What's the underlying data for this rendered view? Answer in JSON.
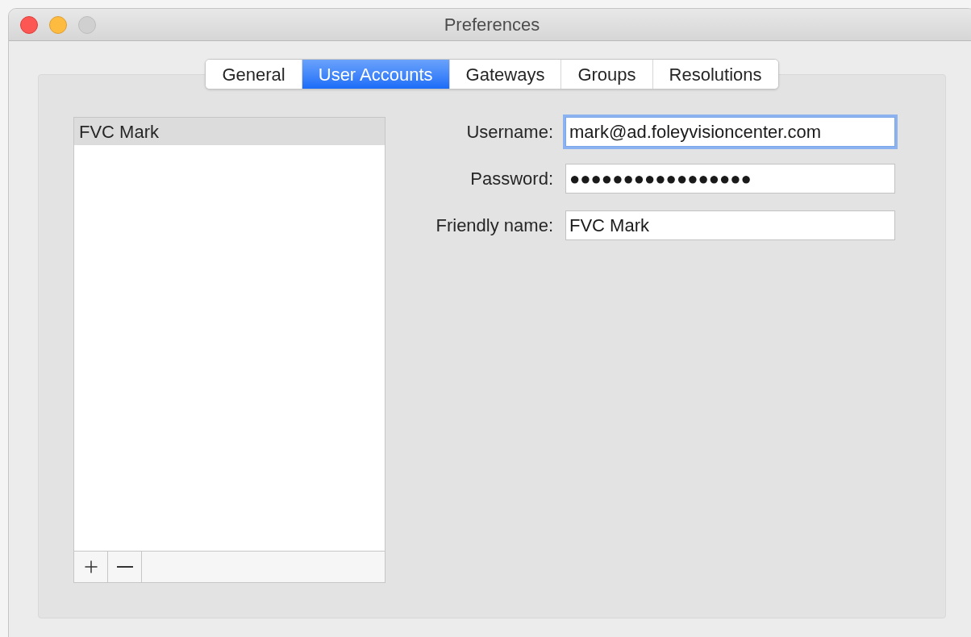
{
  "window": {
    "title": "Preferences"
  },
  "tabs": [
    {
      "label": "General",
      "selected": false
    },
    {
      "label": "User Accounts",
      "selected": true
    },
    {
      "label": "Gateways",
      "selected": false
    },
    {
      "label": "Groups",
      "selected": false
    },
    {
      "label": "Resolutions",
      "selected": false
    }
  ],
  "accounts": [
    {
      "name": "FVC Mark",
      "selected": true
    }
  ],
  "fields": [
    {
      "label": "Username:",
      "value": "mark@ad.foleyvisioncenter.com",
      "focused": true
    },
    {
      "label": "Password:",
      "value": "●●●●●●●●●●●●●●●●●",
      "focused": false
    },
    {
      "label": "Friendly name:",
      "value": "FVC Mark",
      "focused": false
    }
  ]
}
